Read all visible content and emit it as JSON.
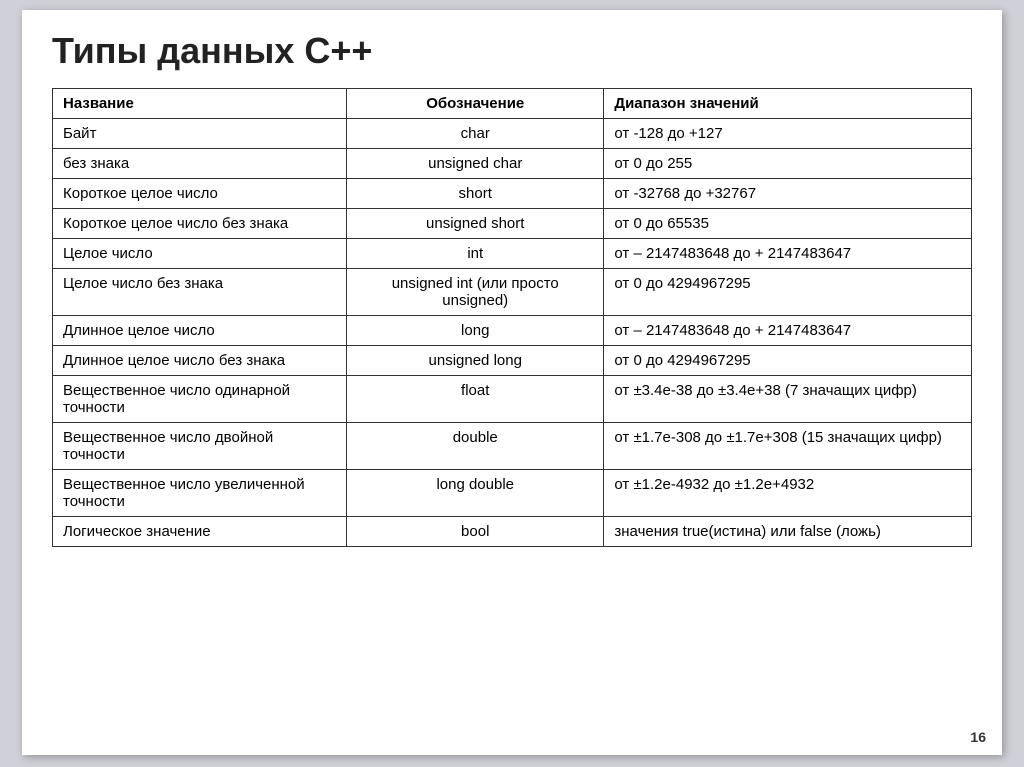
{
  "title": "Типы данных С++",
  "table": {
    "headers": [
      "Название",
      "Обозначение",
      "Диапазон значений"
    ],
    "rows": [
      {
        "name": "Байт",
        "notation": "char",
        "range": "от -128 до +127"
      },
      {
        "name": "без знака",
        "notation": "unsigned char",
        "range": "от 0 до 255"
      },
      {
        "name": "Короткое целое число",
        "notation": "short",
        "range": "от -32768 до +32767"
      },
      {
        "name": "Короткое целое число без знака",
        "notation": "unsigned short",
        "range": "от 0 до 65535"
      },
      {
        "name": "Целое число",
        "notation": "int",
        "range": "от – 2147483648 до + 2147483647"
      },
      {
        "name": "Целое число без знака",
        "notation": "unsigned int (или просто unsigned)",
        "range": "от 0 до 4294967295"
      },
      {
        "name": "Длинное целое число",
        "notation": "long",
        "range": "от – 2147483648 до + 2147483647"
      },
      {
        "name": "Длинное целое число без знака",
        "notation": "unsigned long",
        "range": "от 0 до 4294967295"
      },
      {
        "name": "Вещественное число одинарной точности",
        "notation": "float",
        "range": "от ±3.4е-38 до ±3.4е+38 (7 значащих цифр)"
      },
      {
        "name": "Вещественное число двойной точности",
        "notation": "double",
        "range": "от ±1.7е-308 до ±1.7е+308 (15 значащих цифр)"
      },
      {
        "name": "Вещественное число увеличенной точности",
        "notation": "long double",
        "range": "от ±1.2е-4932 до ±1.2е+4932"
      },
      {
        "name": "Логическое значение",
        "notation": "bool",
        "range": "значения true(истина) или false (ложь)"
      }
    ]
  },
  "page_number": "16"
}
